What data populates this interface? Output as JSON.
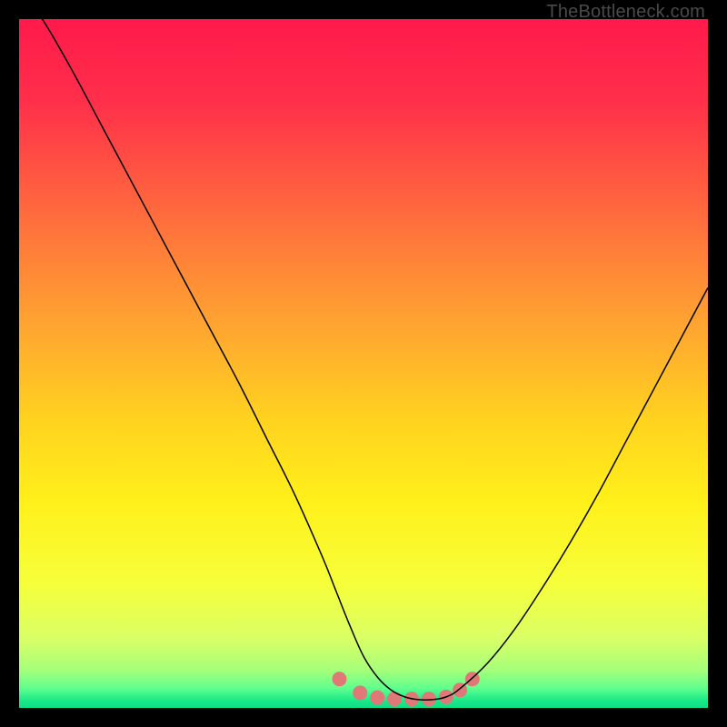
{
  "watermark": "TheBottleneck.com",
  "chart_data": {
    "type": "line",
    "title": "",
    "xlabel": "",
    "ylabel": "",
    "xlim": [
      0,
      100
    ],
    "ylim": [
      0,
      100
    ],
    "grid": false,
    "gradient_stops": [
      {
        "offset": 0.0,
        "color": "#ff1a4b"
      },
      {
        "offset": 0.12,
        "color": "#ff2f4a"
      },
      {
        "offset": 0.28,
        "color": "#ff6a3d"
      },
      {
        "offset": 0.44,
        "color": "#ffa331"
      },
      {
        "offset": 0.58,
        "color": "#ffd21f"
      },
      {
        "offset": 0.7,
        "color": "#fff01a"
      },
      {
        "offset": 0.82,
        "color": "#f6ff3a"
      },
      {
        "offset": 0.9,
        "color": "#d9ff66"
      },
      {
        "offset": 0.945,
        "color": "#a6ff7a"
      },
      {
        "offset": 0.972,
        "color": "#5eff8e"
      },
      {
        "offset": 0.99,
        "color": "#17e889"
      },
      {
        "offset": 1.0,
        "color": "#0fdd85"
      }
    ],
    "series": [
      {
        "name": "bottleneck-curve",
        "color": "#000000",
        "width": 1.5,
        "x": [
          0,
          4,
          8,
          12,
          16,
          20,
          24,
          28,
          32,
          36,
          40,
          44,
          46,
          48,
          50,
          52,
          54,
          56,
          58,
          60,
          62,
          64,
          68,
          72,
          76,
          80,
          84,
          88,
          92,
          96,
          100
        ],
        "y": [
          105,
          99,
          92,
          84.5,
          77,
          69.5,
          62,
          54.5,
          47,
          39,
          31,
          22,
          17,
          12,
          7.5,
          4.5,
          2.6,
          1.6,
          1.2,
          1.2,
          1.6,
          2.8,
          6.5,
          11.5,
          17.5,
          24,
          31,
          38.5,
          46,
          53.5,
          61
        ]
      }
    ],
    "markers": {
      "name": "highlight-dots",
      "color": "#e07878",
      "radius": 8,
      "x": [
        46.5,
        49.5,
        52,
        54.5,
        57,
        59.5,
        62,
        64,
        65.8
      ],
      "y": [
        4.2,
        2.2,
        1.5,
        1.3,
        1.3,
        1.3,
        1.6,
        2.6,
        4.2
      ]
    }
  }
}
